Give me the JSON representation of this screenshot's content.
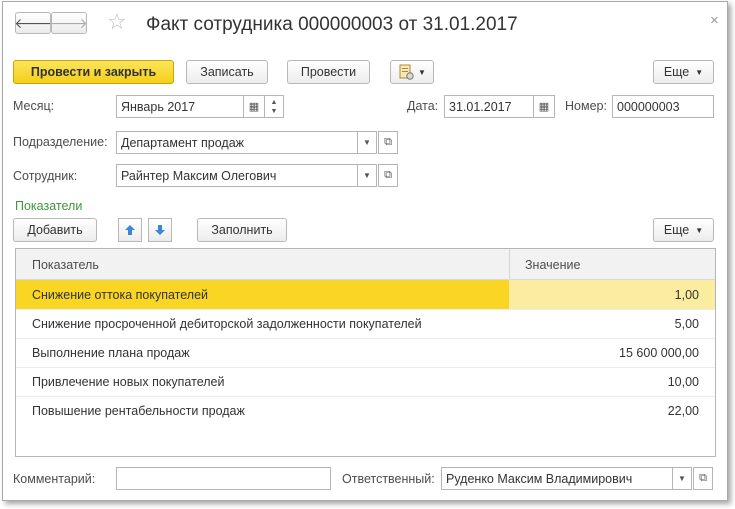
{
  "window": {
    "title": "Факт сотрудника 000000003 от 31.01.2017",
    "close": "×"
  },
  "nav": {
    "back": "🡐",
    "forward": "🡒",
    "favorite": "☆"
  },
  "toolbar": {
    "post_close": "Провести и закрыть",
    "save": "Записать",
    "post": "Провести",
    "more": "Еще"
  },
  "form": {
    "month_label": "Месяц:",
    "month_value": "Январь 2017",
    "date_label": "Дата:",
    "date_value": "31.01.2017",
    "number_label": "Номер:",
    "number_value": "000000003",
    "department_label": "Подразделение:",
    "department_value": "Департамент продаж",
    "employee_label": "Сотрудник:",
    "employee_value": "Райнтер Максим Олегович"
  },
  "indicators": {
    "section_title": "Показатели",
    "add": "Добавить",
    "fill": "Заполнить",
    "more": "Еще",
    "columns": [
      "Показатель",
      "Значение"
    ],
    "rows": [
      {
        "name": "Снижение оттока покупателей",
        "value": "1,00"
      },
      {
        "name": "Снижение просроченной дебиторской задолженности покупателей",
        "value": "5,00"
      },
      {
        "name": "Выполнение плана продаж",
        "value": "15 600 000,00"
      },
      {
        "name": "Привлечение новых покупателей",
        "value": "10,00"
      },
      {
        "name": "Повышение рентабельности продаж",
        "value": "22,00"
      }
    ]
  },
  "footer": {
    "comment_label": "Комментарий:",
    "comment_value": "",
    "responsible_label": "Ответственный:",
    "responsible_value": "Руденко Максим Владимирович"
  },
  "colors": {
    "primary": "#f4cf1a",
    "selected_row": "#f9d524",
    "section_green": "#3a9a3a"
  }
}
